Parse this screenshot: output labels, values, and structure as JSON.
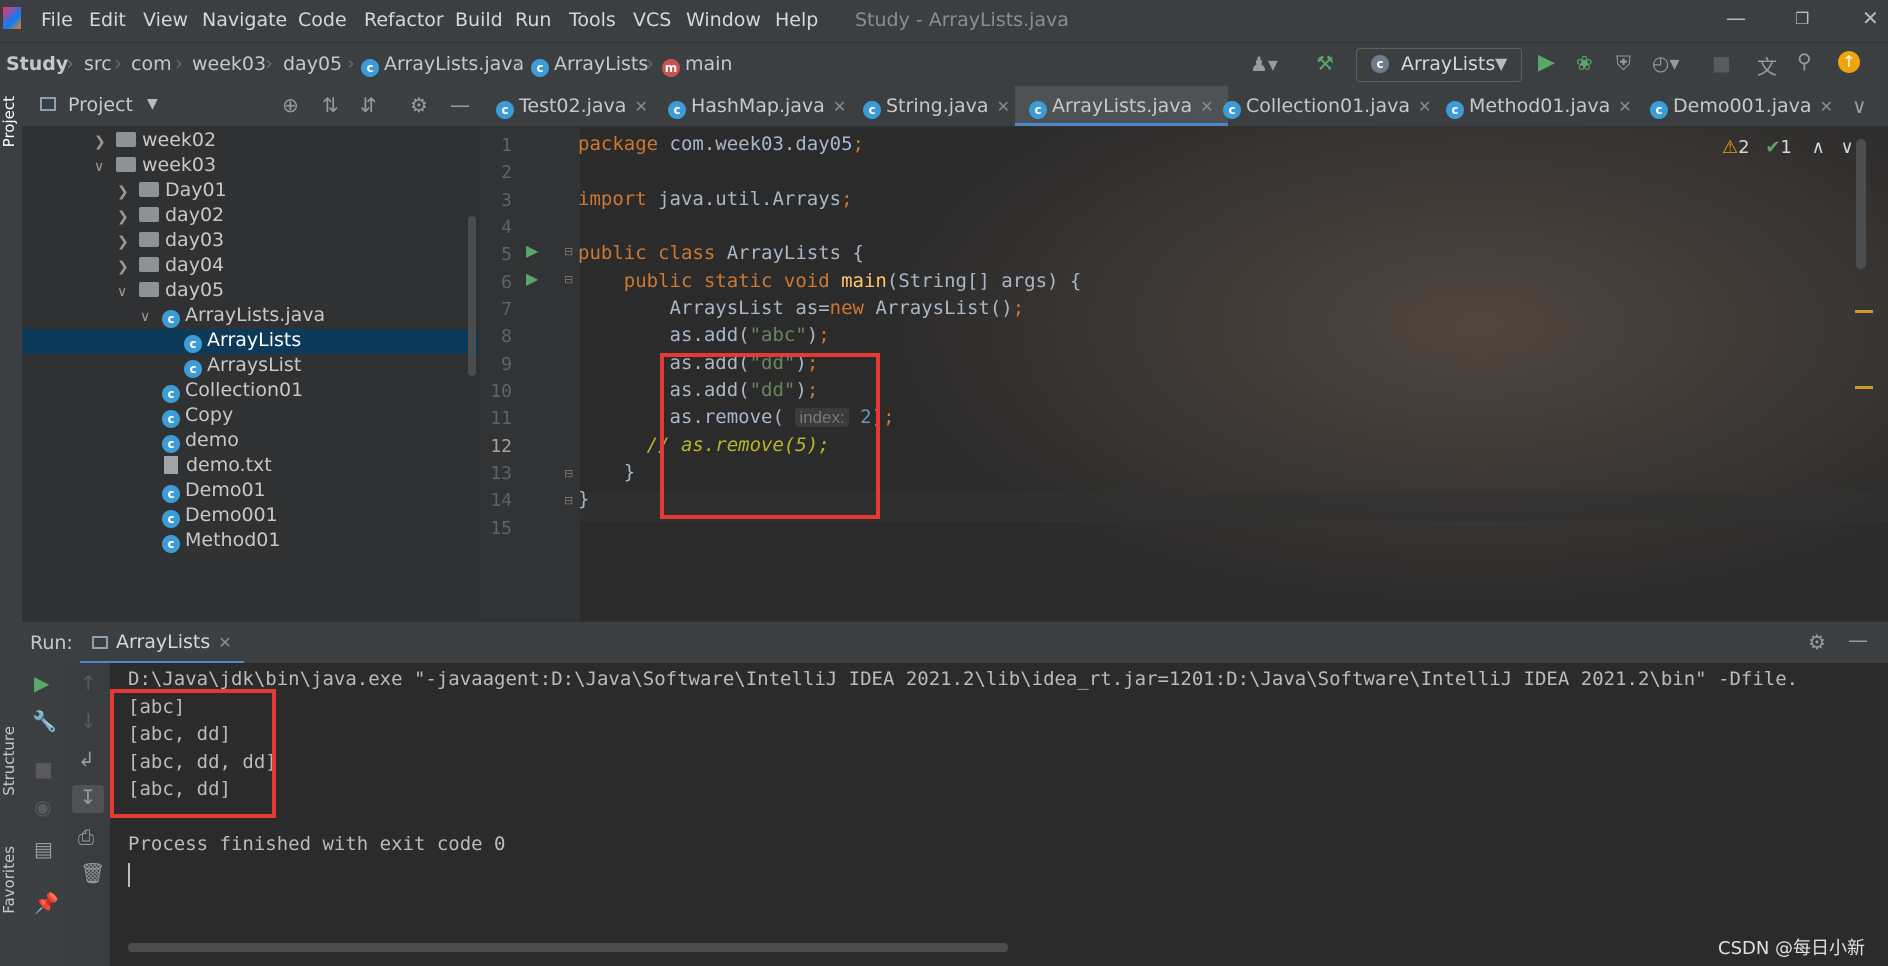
{
  "menubar": {
    "items": [
      "File",
      "Edit",
      "View",
      "Navigate",
      "Code",
      "Refactor",
      "Build",
      "Run",
      "Tools",
      "VCS",
      "Window",
      "Help"
    ],
    "window_title": "Study - ArrayLists.java"
  },
  "breadcrumb": {
    "items": [
      "Study",
      "src",
      "com",
      "week03",
      "day05",
      "ArrayLists.java",
      "ArrayLists",
      "main"
    ]
  },
  "run_config": {
    "label": "ArrayLists"
  },
  "left_strip": {
    "project_label": "Project",
    "structure_label": "Structure",
    "favorites_label": "Favorites"
  },
  "project_panel": {
    "title": "Project",
    "tree": [
      {
        "label": "week02",
        "type": "folder",
        "expanded": false
      },
      {
        "label": "week03",
        "type": "folder",
        "expanded": true
      },
      {
        "label": "Day01",
        "type": "folder",
        "expanded": false
      },
      {
        "label": "day02",
        "type": "folder",
        "expanded": false
      },
      {
        "label": "day03",
        "type": "folder",
        "expanded": false
      },
      {
        "label": "day04",
        "type": "folder",
        "expanded": false
      },
      {
        "label": "day05",
        "type": "folder",
        "expanded": true
      },
      {
        "label": "ArrayLists.java",
        "type": "javafile",
        "expanded": true
      },
      {
        "label": "ArrayLists",
        "type": "class",
        "selected": true
      },
      {
        "label": "ArraysList",
        "type": "class"
      },
      {
        "label": "Collection01",
        "type": "class"
      },
      {
        "label": "Copy",
        "type": "class"
      },
      {
        "label": "demo",
        "type": "class"
      },
      {
        "label": "demo.txt",
        "type": "text"
      },
      {
        "label": "Demo01",
        "type": "class"
      },
      {
        "label": "Demo001",
        "type": "class"
      },
      {
        "label": "Method01",
        "type": "class"
      }
    ]
  },
  "tabs": [
    {
      "label": "Test02.java"
    },
    {
      "label": "HashMap.java"
    },
    {
      "label": "String.java"
    },
    {
      "label": "ArrayLists.java",
      "active": true
    },
    {
      "label": "Collection01.java"
    },
    {
      "label": "Method01.java"
    },
    {
      "label": "Demo001.java"
    }
  ],
  "inspections": {
    "warnings": "2",
    "ok": "1"
  },
  "editor": {
    "line_numbers": [
      "1",
      "2",
      "3",
      "4",
      "5",
      "6",
      "7",
      "8",
      "9",
      "10",
      "11",
      "12",
      "13",
      "14",
      "15"
    ],
    "current_line": "12"
  },
  "run_panel": {
    "label": "Run:",
    "tab": "ArrayLists",
    "output": [
      "D:\\Java\\jdk\\bin\\java.exe \"-javaagent:D:\\Java\\Software\\IntelliJ IDEA 2021.2\\lib\\idea_rt.jar=1201:D:\\Java\\Software\\IntelliJ IDEA 2021.2\\bin\" -Dfile.",
      "[abc]",
      "[abc, dd]",
      "[abc, dd, dd]",
      "[abc, dd]",
      "",
      "Process finished with exit code 0"
    ]
  },
  "watermark": "CSDN @每日小新",
  "colors": {
    "keyword": "#cc7832",
    "string": "#6a8759",
    "number": "#6897bb",
    "highlight_box": "#e53935",
    "selection": "#0d3a58"
  }
}
